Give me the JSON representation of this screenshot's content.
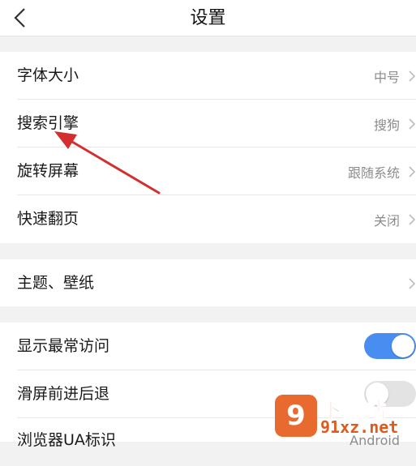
{
  "header": {
    "title": "设置"
  },
  "groups": {
    "display": [
      {
        "label": "字体大小",
        "value": "中号"
      },
      {
        "label": "搜索引擎",
        "value": "搜狗"
      },
      {
        "label": "旋转屏幕",
        "value": "跟随系统"
      },
      {
        "label": "快速翻页",
        "value": "关闭"
      }
    ],
    "theme": [
      {
        "label": "主题、壁纸"
      }
    ],
    "browse": [
      {
        "label": "显示最常访问",
        "toggle": true
      },
      {
        "label": "滑屏前进后退",
        "toggle": false
      },
      {
        "label": "浏览器UA标识",
        "value": "Android"
      }
    ]
  },
  "annotation": {
    "arrow_color": "#d32f2f"
  },
  "watermark": {
    "line1": "下载站",
    "line2": "91xz.net",
    "mark": "9"
  },
  "colors": {
    "accent": "#4a8df0",
    "background": "#f2f2f2"
  }
}
